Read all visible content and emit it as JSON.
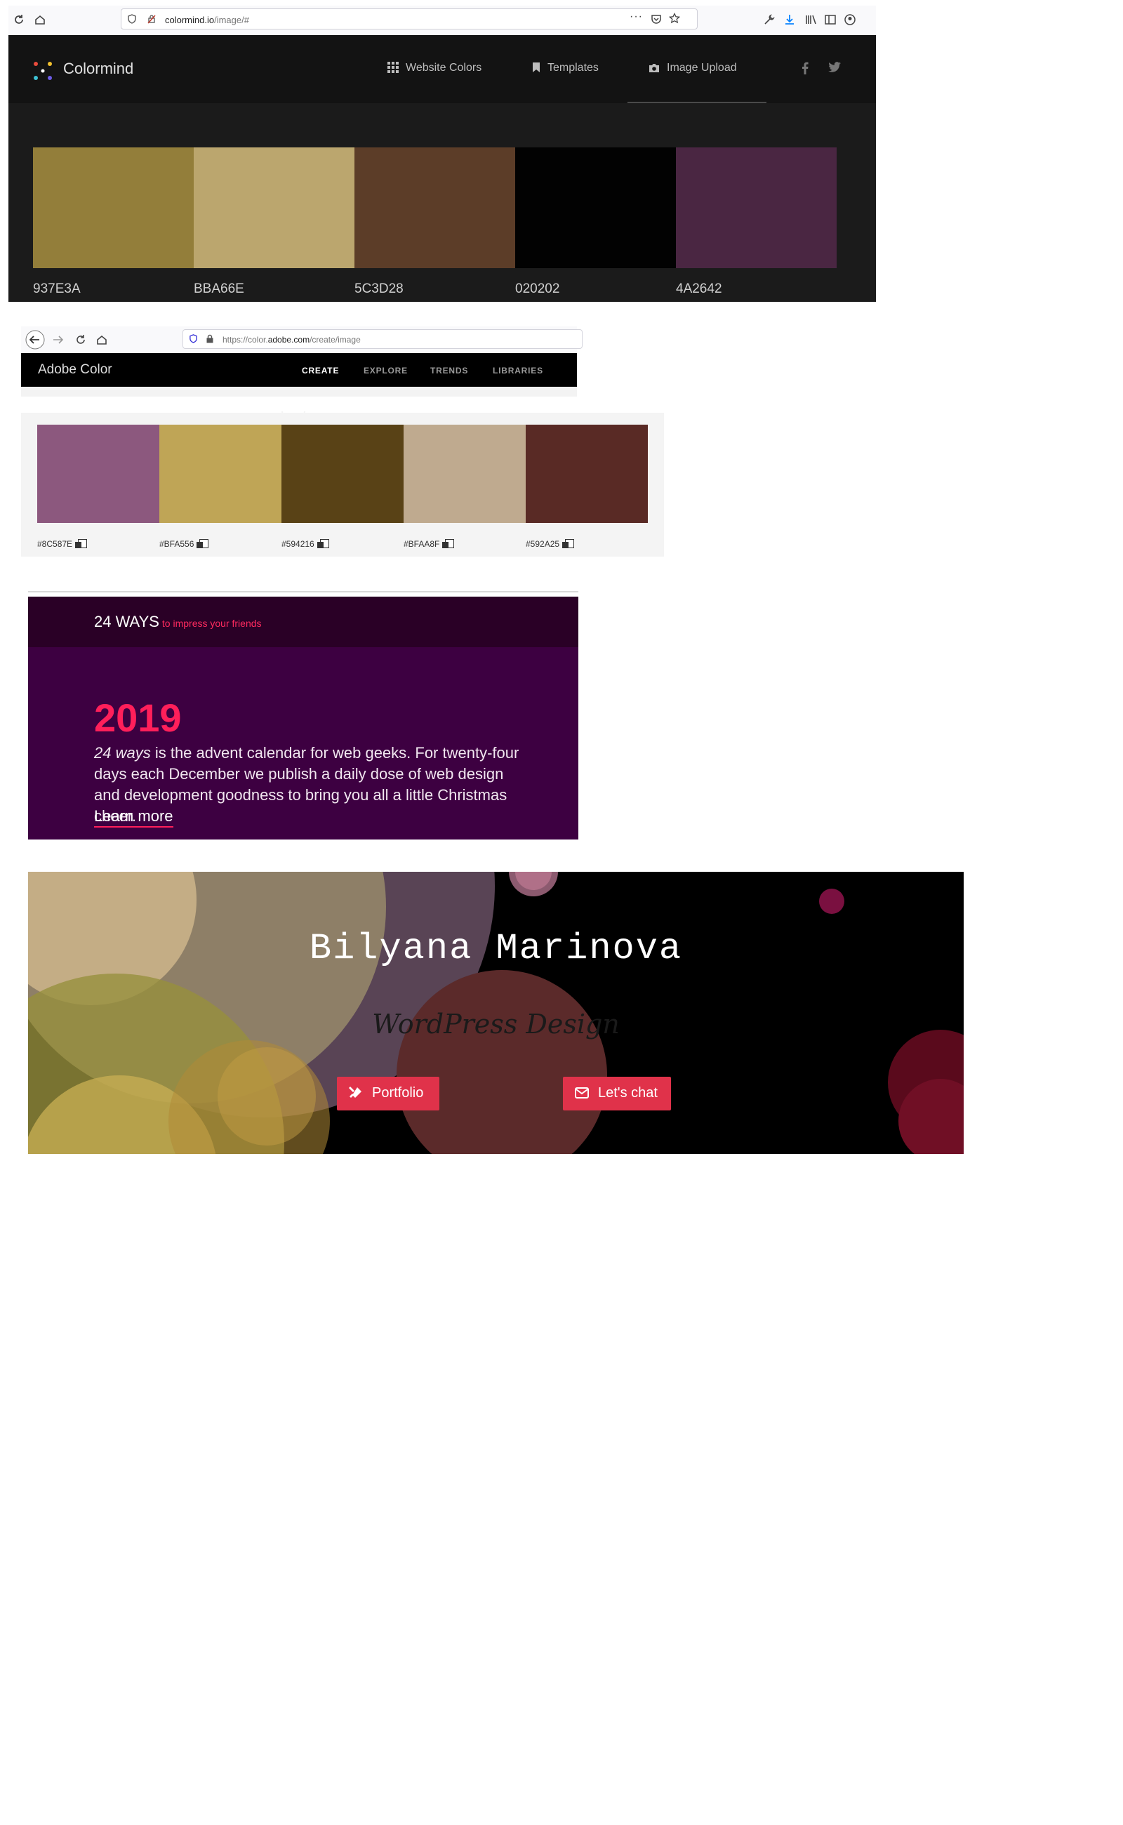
{
  "colormind": {
    "browser": {
      "url_host": "colormind.io",
      "url_path": "/image/#",
      "more_icon": "more-horizontal-icon"
    },
    "nav": {
      "brand": "Colormind",
      "items": [
        {
          "label": "Website Colors",
          "icon": "grid-icon"
        },
        {
          "label": "Templates",
          "icon": "bookmark-icon"
        },
        {
          "label": "Image Upload",
          "icon": "camera-icon"
        }
      ],
      "social": [
        "facebook-icon",
        "twitter-icon"
      ]
    },
    "palette": [
      {
        "hex": "#937E3A",
        "label": "937E3A"
      },
      {
        "hex": "#BBA66E",
        "label": "BBA66E"
      },
      {
        "hex": "#5C3D28",
        "label": "5C3D28"
      },
      {
        "hex": "#020202",
        "label": "020202"
      },
      {
        "hex": "#4A2642",
        "label": "4A2642"
      }
    ]
  },
  "adobe": {
    "browser": {
      "url_prefix": "https://color.",
      "url_host": "adobe.com",
      "url_path": "/create/image"
    },
    "header": {
      "brand": "Adobe Color",
      "nav": [
        "CREATE",
        "EXPLORE",
        "TRENDS",
        "LIBRARIES"
      ],
      "active": "CREATE"
    },
    "palette": [
      {
        "hex": "#8C587E",
        "label": "#8C587E"
      },
      {
        "hex": "#BFA556",
        "label": "#BFA556"
      },
      {
        "hex": "#594216",
        "label": "#594216"
      },
      {
        "hex": "#BFAA8F",
        "label": "#BFAA8F"
      },
      {
        "hex": "#592A25",
        "label": "#592A25"
      }
    ]
  },
  "ways": {
    "title": "24 WAYS",
    "tagline": "to impress your friends",
    "year": "2019",
    "desc_em": "24 ways",
    "desc_rest": " is the advent calendar for web geeks. For twenty-four days each December we publish a daily dose of web design and development goodness to bring you all a little Christmas cheer.",
    "learn_more": "Learn more"
  },
  "bilyana": {
    "name": "Bilyana Marinova",
    "subtitle": "WordPress Design",
    "buttons": [
      {
        "label": "Portfolio",
        "icon": "tools-icon"
      },
      {
        "label": "Let's chat",
        "icon": "envelope-icon"
      }
    ],
    "colors": {
      "button": "#e0324a"
    }
  }
}
